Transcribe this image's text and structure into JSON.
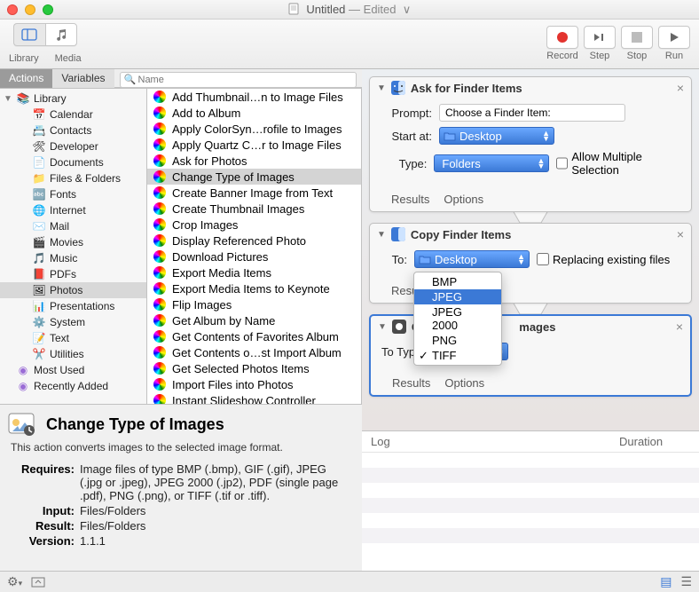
{
  "window": {
    "title": "Untitled",
    "edited": "— Edited"
  },
  "toolbar": {
    "left": [
      {
        "name": "library",
        "label": "Library"
      },
      {
        "name": "media",
        "label": "Media"
      }
    ],
    "right": [
      {
        "name": "record",
        "label": "Record"
      },
      {
        "name": "step",
        "label": "Step"
      },
      {
        "name": "stop",
        "label": "Stop"
      },
      {
        "name": "run",
        "label": "Run"
      }
    ]
  },
  "sidebar": {
    "tabs": {
      "actions": "Actions",
      "variables": "Variables"
    },
    "search_placeholder": "Name",
    "root": "Library",
    "categories": [
      "Calendar",
      "Contacts",
      "Developer",
      "Documents",
      "Files & Folders",
      "Fonts",
      "Internet",
      "Mail",
      "Movies",
      "Music",
      "PDFs",
      "Photos",
      "Presentations",
      "System",
      "Text",
      "Utilities"
    ],
    "smart": [
      "Most Used",
      "Recently Added"
    ],
    "selected": "Photos"
  },
  "actions": {
    "items": [
      "Add Thumbnail…n to Image Files",
      "Add to Album",
      "Apply ColorSyn…rofile to Images",
      "Apply Quartz C…r to Image Files",
      "Ask for Photos",
      "Change Type of Images",
      "Create Banner Image from Text",
      "Create Thumbnail Images",
      "Crop Images",
      "Display Referenced Photo",
      "Download Pictures",
      "Export Media Items",
      "Export Media Items to Keynote",
      "Flip Images",
      "Get Album by Name",
      "Get Contents of Favorites Album",
      "Get Contents o…st Import Album",
      "Get Selected Photos Items",
      "Import Files into Photos",
      "Instant Slideshow Controller"
    ],
    "selected": "Change Type of Images"
  },
  "info": {
    "title": "Change Type of Images",
    "desc": "This action converts images to the selected image format.",
    "requires": "Image files of type BMP (.bmp), GIF (.gif), JPEG (.jpg or .jpeg), JPEG 2000 (.jp2), PDF (single page .pdf), PNG (.png), or TIFF (.tif or .tiff).",
    "input": "Files/Folders",
    "result": "Files/Folders",
    "version": "1.1.1",
    "labels": {
      "requires": "Requires:",
      "input": "Input:",
      "result": "Result:",
      "version": "Version:"
    }
  },
  "workflow": {
    "cards": [
      {
        "title": "Ask for Finder Items",
        "rows": {
          "prompt_label": "Prompt:",
          "prompt_value": "Choose a Finder Item:",
          "start_label": "Start at:",
          "start_value": "Desktop",
          "type_label": "Type:",
          "type_value": "Folders",
          "allow_label": "Allow Multiple Selection"
        }
      },
      {
        "title": "Copy Finder Items",
        "rows": {
          "to_label": "To:",
          "to_value": "Desktop",
          "replace_label": "Replacing existing files"
        }
      },
      {
        "title": "C                               mages",
        "rows": {
          "totype_label": "To Type"
        }
      }
    ],
    "footer": {
      "results": "Results",
      "options": "Options"
    },
    "popup": {
      "options": [
        "BMP",
        "JPEG",
        "JPEG 2000",
        "PNG",
        "TIFF"
      ],
      "highlighted": "JPEG",
      "checked": "TIFF"
    }
  },
  "log": {
    "col1": "Log",
    "col2": "Duration"
  }
}
